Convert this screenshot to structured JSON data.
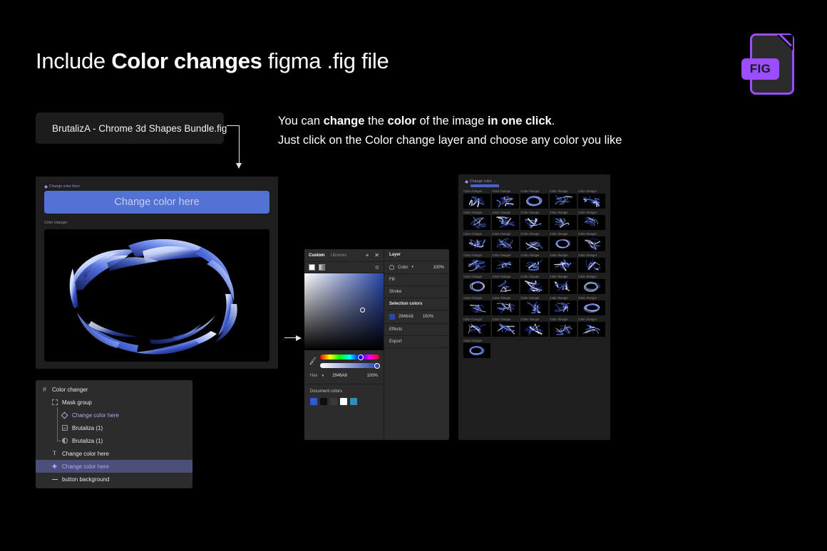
{
  "headline": {
    "pre": "Include ",
    "bold": "Color changes",
    "post": " figma .fig file"
  },
  "fig_badge": {
    "label": "FIG",
    "accent": "#9b4dff"
  },
  "file_card": {
    "name": "BrutalizA - Chrome 3d Shapes Bundle.fig",
    "icon": "document-icon"
  },
  "body_copy": {
    "line1_a": "You can ",
    "line1_b": "change",
    "line1_c": " the ",
    "line1_d": "color",
    "line1_e": " of the image ",
    "line1_f": "in one click",
    "line1_g": ".",
    "line2": "Just click on the Color change layer and choose any color you like"
  },
  "preview": {
    "selection_label": "Change color here",
    "frame_label": "Color changer",
    "button_text": "Change color here",
    "button_color": "#5271d4"
  },
  "layers": {
    "items": [
      {
        "label": "Color changer",
        "icon": "frame-icon",
        "indent": 0,
        "violet": false,
        "selected": false
      },
      {
        "label": "Mask group",
        "icon": "mask-icon",
        "indent": 1,
        "violet": false,
        "selected": false
      },
      {
        "label": "Change color here",
        "icon": "diamond-icon",
        "indent": 2,
        "violet": true,
        "selected": false
      },
      {
        "label": "Brutaliza (1)",
        "icon": "image-icon",
        "indent": 2,
        "violet": false,
        "selected": false
      },
      {
        "label": "Brutaliza (1)",
        "icon": "boolean-icon",
        "indent": 2,
        "violet": false,
        "selected": false
      },
      {
        "label": "Change color here",
        "icon": "text-icon",
        "indent": 1,
        "violet": false,
        "selected": false
      },
      {
        "label": "Change color here",
        "icon": "component-icon",
        "indent": 1,
        "violet": true,
        "selected": true
      },
      {
        "label": "button background",
        "icon": "line-icon",
        "indent": 1,
        "violet": false,
        "selected": false
      }
    ],
    "selected_bg": "#4b4f7a"
  },
  "picker": {
    "tabs": {
      "custom": "Custom",
      "libraries": "Libraries"
    },
    "add_icon": "plus-icon",
    "close_icon": "close-icon",
    "gear_icon": "gear-icon",
    "eyedropper_icon": "eyedropper-icon",
    "hex_label": "Hex",
    "hex_value": "2946A8",
    "opacity": "100%",
    "document_colors_label": "Document colors",
    "document_colors": [
      "#2f5bd0",
      "#0e0e0e",
      "#3a3a3a",
      "#ffffff",
      "#2b8fc4"
    ],
    "picked_color": "#2946A8"
  },
  "inspector": {
    "layer_label": "Layer",
    "color_label": "Color",
    "color_opacity": "100%",
    "fill_label": "Fill",
    "stroke_label": "Stroke",
    "selection_colors_label": "Selection colors",
    "selection_hex": "2946A8",
    "selection_pct": "100%",
    "effects_label": "Effects",
    "export_label": "Export"
  },
  "grid": {
    "header_label": "Change color ...",
    "caption": "Color changer",
    "count": 36,
    "columns": 5
  }
}
